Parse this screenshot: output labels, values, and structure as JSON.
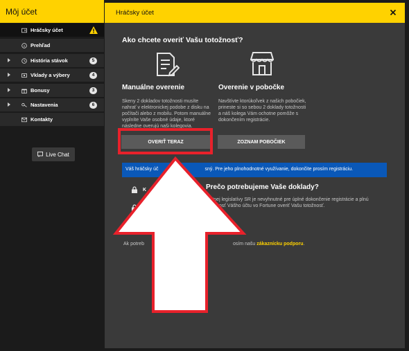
{
  "sidebar": {
    "header": "Môj účet",
    "items": [
      {
        "label": "Hráčsky účet",
        "icon": "id-card-icon",
        "active": true,
        "warning": true
      },
      {
        "label": "Prehľad",
        "icon": "circle-info-icon"
      },
      {
        "label": "História stávok",
        "icon": "clock-icon",
        "badge": "5",
        "expandable": true
      },
      {
        "label": "Vklady a výbery",
        "icon": "money-icon",
        "badge": "4",
        "expandable": true
      },
      {
        "label": "Bonusy",
        "icon": "gift-icon",
        "badge": "3",
        "expandable": true
      },
      {
        "label": "Nastavenia",
        "icon": "key-icon",
        "badge": "6",
        "expandable": true
      },
      {
        "label": "Kontakty",
        "icon": "mail-icon"
      }
    ],
    "live_chat": "Live Chat"
  },
  "modal": {
    "title": "Hráčsky účet",
    "question": "Ako chcete overiť Vašu totožnosť?",
    "manual": {
      "title": "Manuálne overenie",
      "desc": "Skeny 2 dokladov totožnosti musíte nahrať v elektronickej podobe z disku na počítači alebo z mobilu. Potom manuálne vyplníte Vaše osobné údaje, ktoré následne overujú naši kolegovia.",
      "button": "OVERIŤ TERAZ"
    },
    "branch": {
      "title": "Overenie v pobočke",
      "desc": "Navštívte ktorúkoľvek z našich pobočiek, prineste si so sebou 2 doklady totožnosti a náš kolega Vám ochotne pomôže s dokončením registrácie.",
      "button": "ZOZNAM POBOČIEK"
    },
    "info_bar": {
      "start": "Váš hráčsky úč",
      "end": "sný. Pre jeho plnohodnotné využívanie, dokončite prosím registráciu."
    },
    "lock_letter": "K",
    "why": {
      "title": "Prečo potrebujeme Vaše doklady?",
      "line1": "platnej legislatívy SR je nevyhnutné pre úplné dokončenie registrácie a plnú",
      "line2": "nosť Vášho účtu vo Fortune overiť Vašu totožnosť."
    },
    "support": {
      "start": "Ak potreb",
      "middle": "osím našu ",
      "link": "zákaznícku podporu",
      "end": "."
    }
  },
  "colors": {
    "accent": "#ffd200",
    "highlight": "#e8212b",
    "info": "#0a58b8"
  }
}
